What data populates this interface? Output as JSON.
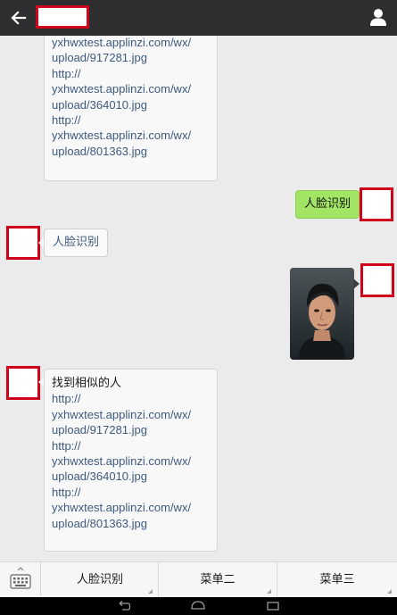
{
  "header": {
    "back_icon": "arrow-left-icon",
    "title": "",
    "profile_icon": "person-icon"
  },
  "messages": {
    "top_card_lines": [
      "yxhwxtest.applinzi.com/wx/",
      "upload/917281.jpg",
      "http://",
      "yxhwxtest.applinzi.com/wx/",
      "upload/364010.jpg",
      "http://",
      "yxhwxtest.applinzi.com/wx/",
      "upload/801363.jpg"
    ],
    "sent_text": "人脸识别",
    "received_text": "人脸识别",
    "bottom_card": {
      "title": "找到相似的人",
      "lines": [
        "http://",
        "yxhwxtest.applinzi.com/wx/",
        "upload/917281.jpg",
        "http://",
        "yxhwxtest.applinzi.com/wx/",
        "upload/364010.jpg",
        "http://",
        "yxhwxtest.applinzi.com/wx/",
        "upload/801363.jpg"
      ]
    }
  },
  "menu": {
    "keyboard_icon": "keyboard-icon",
    "item1": "人脸识别",
    "item2": "菜单二",
    "item3": "菜单三"
  },
  "system_nav": {
    "back_icon": "nav-back-icon",
    "home_icon": "nav-home-icon",
    "recents_icon": "nav-recents-icon"
  },
  "colors": {
    "header_bg": "#2e2e30",
    "chat_bg": "#ebebeb",
    "sent_bubble": "#a2e463",
    "link_text": "#3d5a7e",
    "avatar_border": "#d0021b"
  }
}
